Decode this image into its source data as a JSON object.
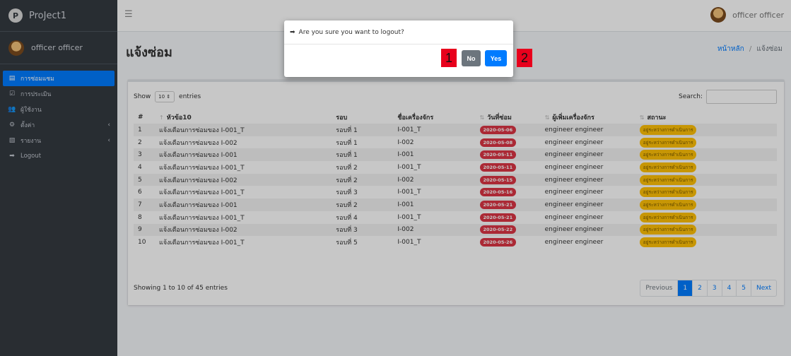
{
  "brand": {
    "letter": "P",
    "name": "ProJect1"
  },
  "sidebar": {
    "user_name": "officer officer",
    "items": [
      {
        "label": "การซ่อมแซม",
        "icon": "clipboard-icon",
        "active": true,
        "caret": ""
      },
      {
        "label": "การประเมิน",
        "icon": "checklist-icon",
        "active": false,
        "caret": ""
      },
      {
        "label": "ผู้ใช้งาน",
        "icon": "users-icon",
        "active": false,
        "caret": ""
      },
      {
        "label": "ตั้งค่า",
        "icon": "cog-icon",
        "active": false,
        "caret": "‹"
      },
      {
        "label": "รายงาน",
        "icon": "file-pdf-icon",
        "active": false,
        "caret": "‹"
      },
      {
        "label": "Logout",
        "icon": "logout-icon",
        "active": false,
        "caret": ""
      }
    ]
  },
  "topbar": {
    "user_name": "officer officer"
  },
  "header": {
    "title": "แจ้งซ่อม",
    "breadcrumb_home": "หน้าหลัก",
    "breadcrumb_sep": "/",
    "breadcrumb_current": "แจ้งซ่อม"
  },
  "table_controls": {
    "show_label": "Show",
    "show_value": "10",
    "entries_label": "entries",
    "search_label": "Search:"
  },
  "table": {
    "columns": [
      "#",
      "หัวข้อ10",
      "รอบ",
      "ชื่อเครื่องจักร",
      "วันที่ซ่อม",
      "ผู้เพิ่มเครื่องจักร",
      "สถานะ"
    ],
    "rows": [
      [
        "1",
        "แจ้งเตือนการซ่อมของ I-001_T",
        "รอบที่ 1",
        "I-001_T",
        "2020-05-06",
        "engineer engineer",
        "อยู่ระหว่างการดำเนินการ"
      ],
      [
        "2",
        "แจ้งเตือนการซ่อมของ I-002",
        "รอบที่ 1",
        "I-002",
        "2020-05-08",
        "engineer engineer",
        "อยู่ระหว่างการดำเนินการ"
      ],
      [
        "3",
        "แจ้งเตือนการซ่อมของ I-001",
        "รอบที่ 1",
        "I-001",
        "2020-05-11",
        "engineer engineer",
        "อยู่ระหว่างการดำเนินการ"
      ],
      [
        "4",
        "แจ้งเตือนการซ่อมของ I-001_T",
        "รอบที่ 2",
        "I-001_T",
        "2020-05-11",
        "engineer engineer",
        "อยู่ระหว่างการดำเนินการ"
      ],
      [
        "5",
        "แจ้งเตือนการซ่อมของ I-002",
        "รอบที่ 2",
        "I-002",
        "2020-05-15",
        "engineer engineer",
        "อยู่ระหว่างการดำเนินการ"
      ],
      [
        "6",
        "แจ้งเตือนการซ่อมของ I-001_T",
        "รอบที่ 3",
        "I-001_T",
        "2020-05-16",
        "engineer engineer",
        "อยู่ระหว่างการดำเนินการ"
      ],
      [
        "7",
        "แจ้งเตือนการซ่อมของ I-001",
        "รอบที่ 2",
        "I-001",
        "2020-05-21",
        "engineer engineer",
        "อยู่ระหว่างการดำเนินการ"
      ],
      [
        "8",
        "แจ้งเตือนการซ่อมของ I-001_T",
        "รอบที่ 4",
        "I-001_T",
        "2020-05-21",
        "engineer engineer",
        "อยู่ระหว่างการดำเนินการ"
      ],
      [
        "9",
        "แจ้งเตือนการซ่อมของ I-002",
        "รอบที่ 3",
        "I-002",
        "2020-05-22",
        "engineer engineer",
        "อยู่ระหว่างการดำเนินการ"
      ],
      [
        "10",
        "แจ้งเตือนการซ่อมของ I-001_T",
        "รอบที่ 5",
        "I-001_T",
        "2020-05-26",
        "engineer engineer",
        "อยู่ระหว่างการดำเนินการ"
      ]
    ]
  },
  "footer": {
    "info": "Showing 1 to 10 of 45 entries",
    "pagination": [
      "Previous",
      "1",
      "2",
      "3",
      "4",
      "5",
      "Next"
    ],
    "active_page": "1"
  },
  "modal": {
    "message": "Are you sure you want to logout?",
    "no_label": "No",
    "yes_label": "Yes",
    "marker_1": "1",
    "marker_2": "2"
  },
  "colors": {
    "primary": "#007bff",
    "danger": "#dc3545",
    "warning": "#ffc107",
    "sidebar": "#343a40",
    "marker": "#e8001c"
  }
}
